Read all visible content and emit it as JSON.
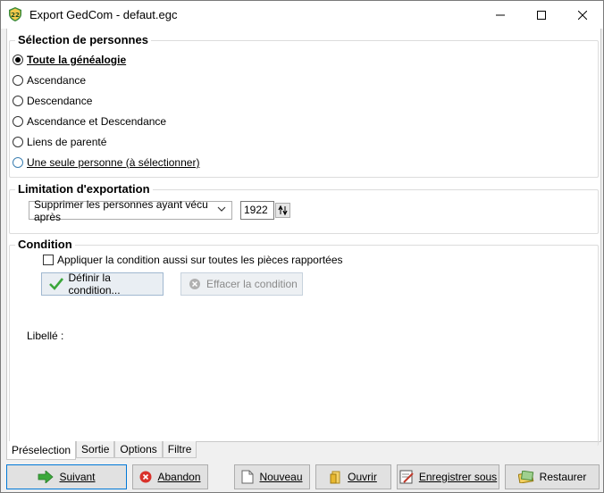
{
  "window": {
    "title": "Export GedCom - defaut.egc",
    "icon_badge": "22"
  },
  "selection": {
    "group_title": "Sélection de personnes",
    "options": [
      {
        "label": "Toute la généalogie",
        "checked": true
      },
      {
        "label": "Ascendance",
        "checked": false
      },
      {
        "label": "Descendance",
        "checked": false
      },
      {
        "label": "Ascendance et Descendance",
        "checked": false
      },
      {
        "label": "Liens de parenté",
        "checked": false
      },
      {
        "label": "Une seule personne (à sélectionner)",
        "checked": false
      }
    ]
  },
  "limitation": {
    "group_title": "Limitation d'exportation",
    "select_value": "Supprimer les personnes ayant vécu après",
    "year": "1922"
  },
  "condition": {
    "group_title": "Condition",
    "checkbox_label": "Appliquer la condition aussi sur toutes les pièces rapportées",
    "define_button": "Définir la condition...",
    "clear_button": "Effacer la condition",
    "libelle_label": "Libellé :"
  },
  "tabs": [
    "Préselection",
    "Sortie",
    "Options",
    "Filtre"
  ],
  "footer": {
    "suivant": "Suivant",
    "abandon": "Abandon",
    "nouveau": "Nouveau",
    "ouvrir": "Ouvrir",
    "enregistrer": "Enregistrer sous",
    "restaurer": "Restaurer"
  }
}
